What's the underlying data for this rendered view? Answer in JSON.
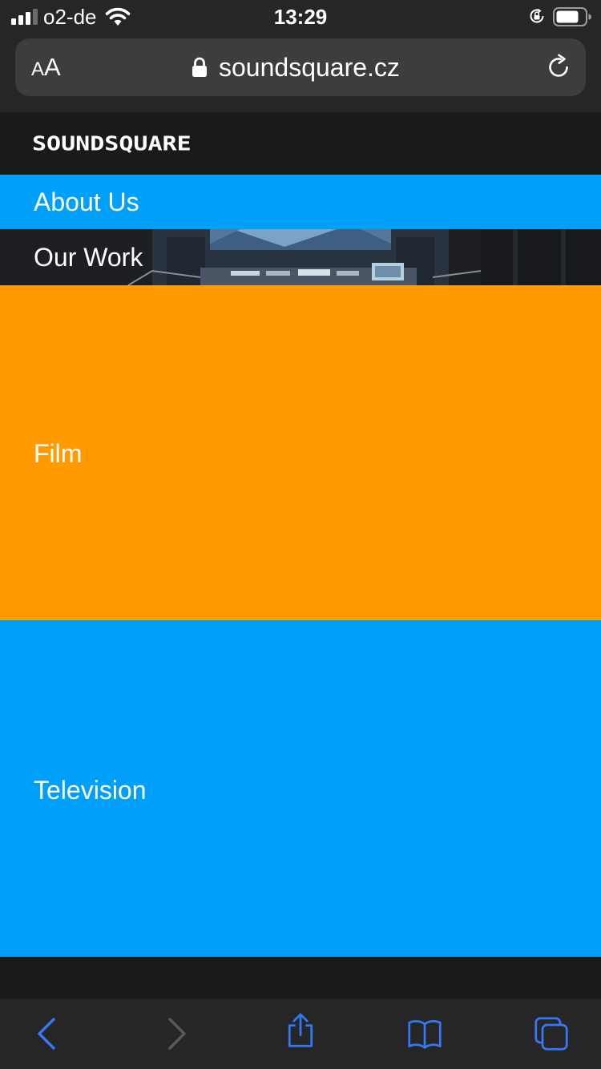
{
  "status_bar": {
    "carrier": "o2-de",
    "time": "13:29",
    "signal_bars_active": 3,
    "signal_bars_total": 4
  },
  "url_bar": {
    "text_size_label_small": "A",
    "text_size_label_large": "A",
    "domain": "soundsquare.cz"
  },
  "site": {
    "logo": "SOUNDSQUARE",
    "nav": {
      "about_label": "About Us",
      "work_label": "Our Work"
    },
    "tiles": [
      {
        "label": "Film",
        "color": "#ff9a00"
      },
      {
        "label": "Television",
        "color": "#00a0fa"
      }
    ]
  },
  "colors": {
    "accent_blue": "#00a0fa",
    "accent_orange": "#ff9a00",
    "browser_chrome": "#262626",
    "toolbar_icon": "#3478f6",
    "toolbar_icon_disabled": "#5a5a5a"
  },
  "toolbar": {
    "icons": [
      "back-icon",
      "forward-icon",
      "share-icon",
      "bookmarks-icon",
      "tabs-icon"
    ]
  }
}
